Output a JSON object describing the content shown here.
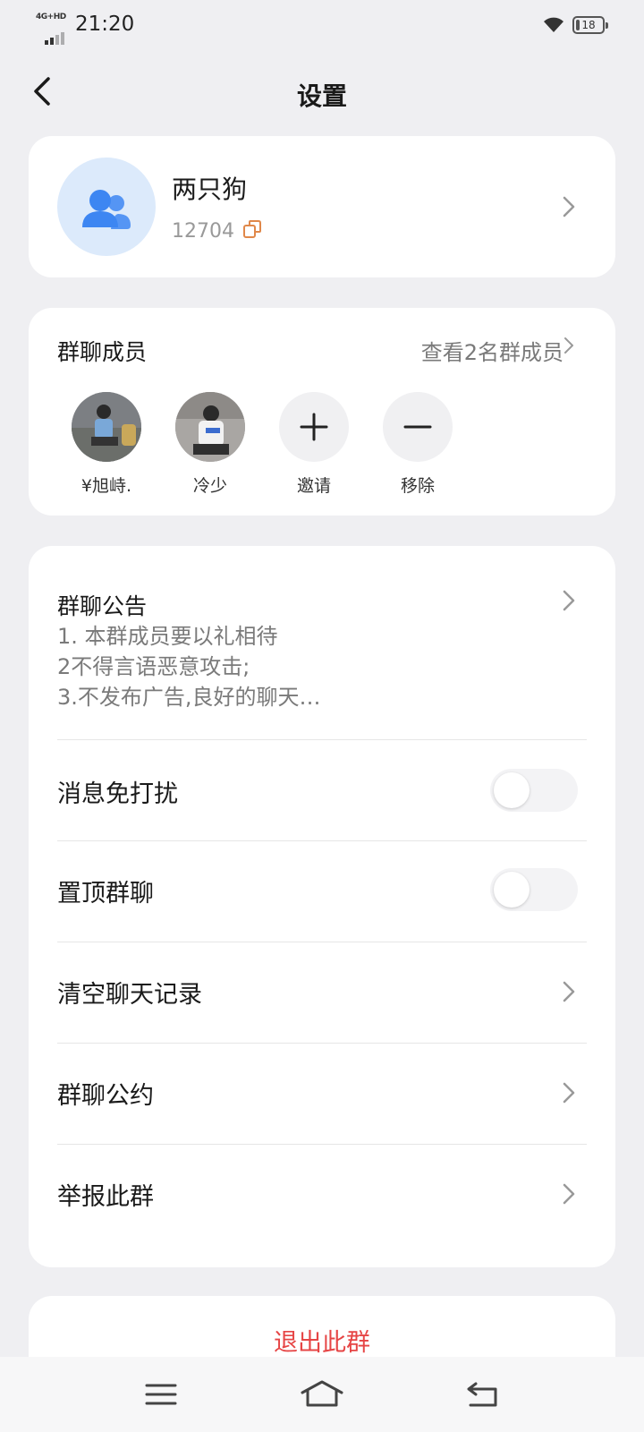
{
  "status_bar": {
    "network": "4G+HD",
    "time": "21:20",
    "battery_level": "18"
  },
  "header": {
    "title": "设置"
  },
  "group": {
    "name": "两只狗",
    "id": "12704"
  },
  "members": {
    "title": "群聊成员",
    "view_all": "查看2名群成员",
    "list": [
      {
        "name": "¥旭峙."
      },
      {
        "name": "冷少"
      }
    ],
    "invite_label": "邀请",
    "remove_label": "移除"
  },
  "announcement": {
    "title": "群聊公告",
    "text": "1. 本群成员要以礼相待\n2不得言语恶意攻击;\n3.不发布广告,良好的聊天…"
  },
  "settings": {
    "mute_label": "消息免打扰",
    "mute_on": false,
    "pin_label": "置顶群聊",
    "pin_on": false,
    "clear_label": "清空聊天记录",
    "rules_label": "群聊公约",
    "report_label": "举报此群"
  },
  "exit": {
    "label": "退出此群"
  },
  "colors": {
    "background": "#efeff2",
    "accent_blue": "#3d86f2",
    "danger": "#e64545",
    "copy_icon": "#e0884a"
  },
  "icons": [
    "back-icon",
    "group-icon",
    "copy-icon",
    "chevron-right-icon",
    "plus-icon",
    "minus-icon",
    "menu-icon",
    "home-icon",
    "return-icon",
    "wifi-icon",
    "battery-icon"
  ]
}
